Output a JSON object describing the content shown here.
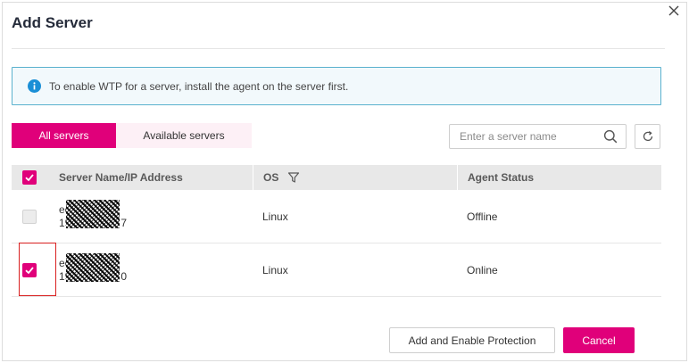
{
  "dialog": {
    "title": "Add Server",
    "close_icon": "close-icon"
  },
  "notice": {
    "icon": "info-icon",
    "text": "To enable WTP for a server, install the agent on the server first."
  },
  "tabs": [
    {
      "label": "All servers",
      "active": true
    },
    {
      "label": "Available servers",
      "active": false
    }
  ],
  "search": {
    "placeholder": "Enter a server name",
    "value": "",
    "icon": "search-icon"
  },
  "refresh": {
    "icon": "refresh-icon"
  },
  "table": {
    "columns": {
      "name": "Server Name/IP Address",
      "os": "OS",
      "status": "Agent Status"
    },
    "header_checked": true,
    "rows": [
      {
        "name_prefix": "ec",
        "ip_prefix": "19",
        "ip_suffix": "7",
        "name_suffix": "",
        "os": "Linux",
        "status": "Offline",
        "checked": false
      },
      {
        "name_prefix": "ec",
        "ip_prefix": "19",
        "ip_suffix": "0",
        "name_suffix": "",
        "os": "Linux",
        "status": "Online",
        "checked": true
      }
    ]
  },
  "buttons": {
    "confirm": "Add and Enable Protection",
    "cancel": "Cancel"
  },
  "colors": {
    "accent": "#e0007a",
    "notice_border": "#5ab1ce",
    "notice_bg": "#f2f9fc",
    "info_icon": "#1a8fd6",
    "selection_frame": "#d92020"
  }
}
